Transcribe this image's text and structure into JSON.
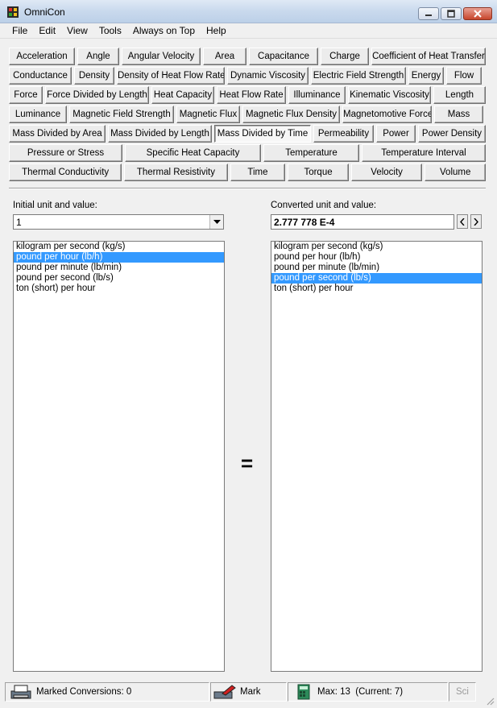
{
  "window": {
    "title": "OmniCon"
  },
  "menu": [
    "File",
    "Edit",
    "View",
    "Tools",
    "Always on Top",
    "Help"
  ],
  "categories": [
    [
      "Acceleration",
      "Angle",
      "Angular Velocity",
      "Area",
      "Capacitance",
      "Charge",
      "Coefficient of Heat Transfer"
    ],
    [
      "Conductance",
      "Density",
      "Density of Heat Flow Rate",
      "Dynamic Viscosity",
      "Electric Field Strength",
      "Energy",
      "Flow"
    ],
    [
      "Force",
      "Force Divided by Length",
      "Heat Capacity",
      "Heat Flow Rate",
      "Illuminance",
      "Kinematic Viscosity",
      "Length"
    ],
    [
      "Luminance",
      "Magnetic Field Strength",
      "Magnetic Flux",
      "Magnetic Flux Density",
      "Magnetomotive Force",
      "Mass"
    ],
    [
      "Mass Divided by Area",
      "Mass Divided by Length",
      "Mass Divided by Time",
      "Permeability",
      "Power",
      "Power Density"
    ],
    [
      "Pressure or Stress",
      "Specific Heat Capacity",
      "Temperature",
      "Temperature Interval"
    ],
    [
      "Thermal Conductivity",
      "Thermal Resistivity",
      "Time",
      "Torque",
      "Velocity",
      "Volume"
    ]
  ],
  "active_category": "Mass Divided by Time",
  "initial": {
    "label": "Initial unit and value:",
    "value": "1"
  },
  "converted": {
    "label": "Converted unit and value:",
    "value": "2.777 778 E-4"
  },
  "units": [
    "kilogram per second (kg/s)",
    "pound per hour (lb/h)",
    "pound per minute (lb/min)",
    "pound per second (lb/s)",
    "ton (short) per hour"
  ],
  "initial_selected": "pound per hour (lb/h)",
  "converted_selected": "pound per second (lb/s)",
  "equals_sign": "=",
  "status": {
    "marked": "Marked Conversions: 0",
    "mark": "Mark",
    "max": "Max: 13  (Current: 7)",
    "sci": "Sci"
  }
}
